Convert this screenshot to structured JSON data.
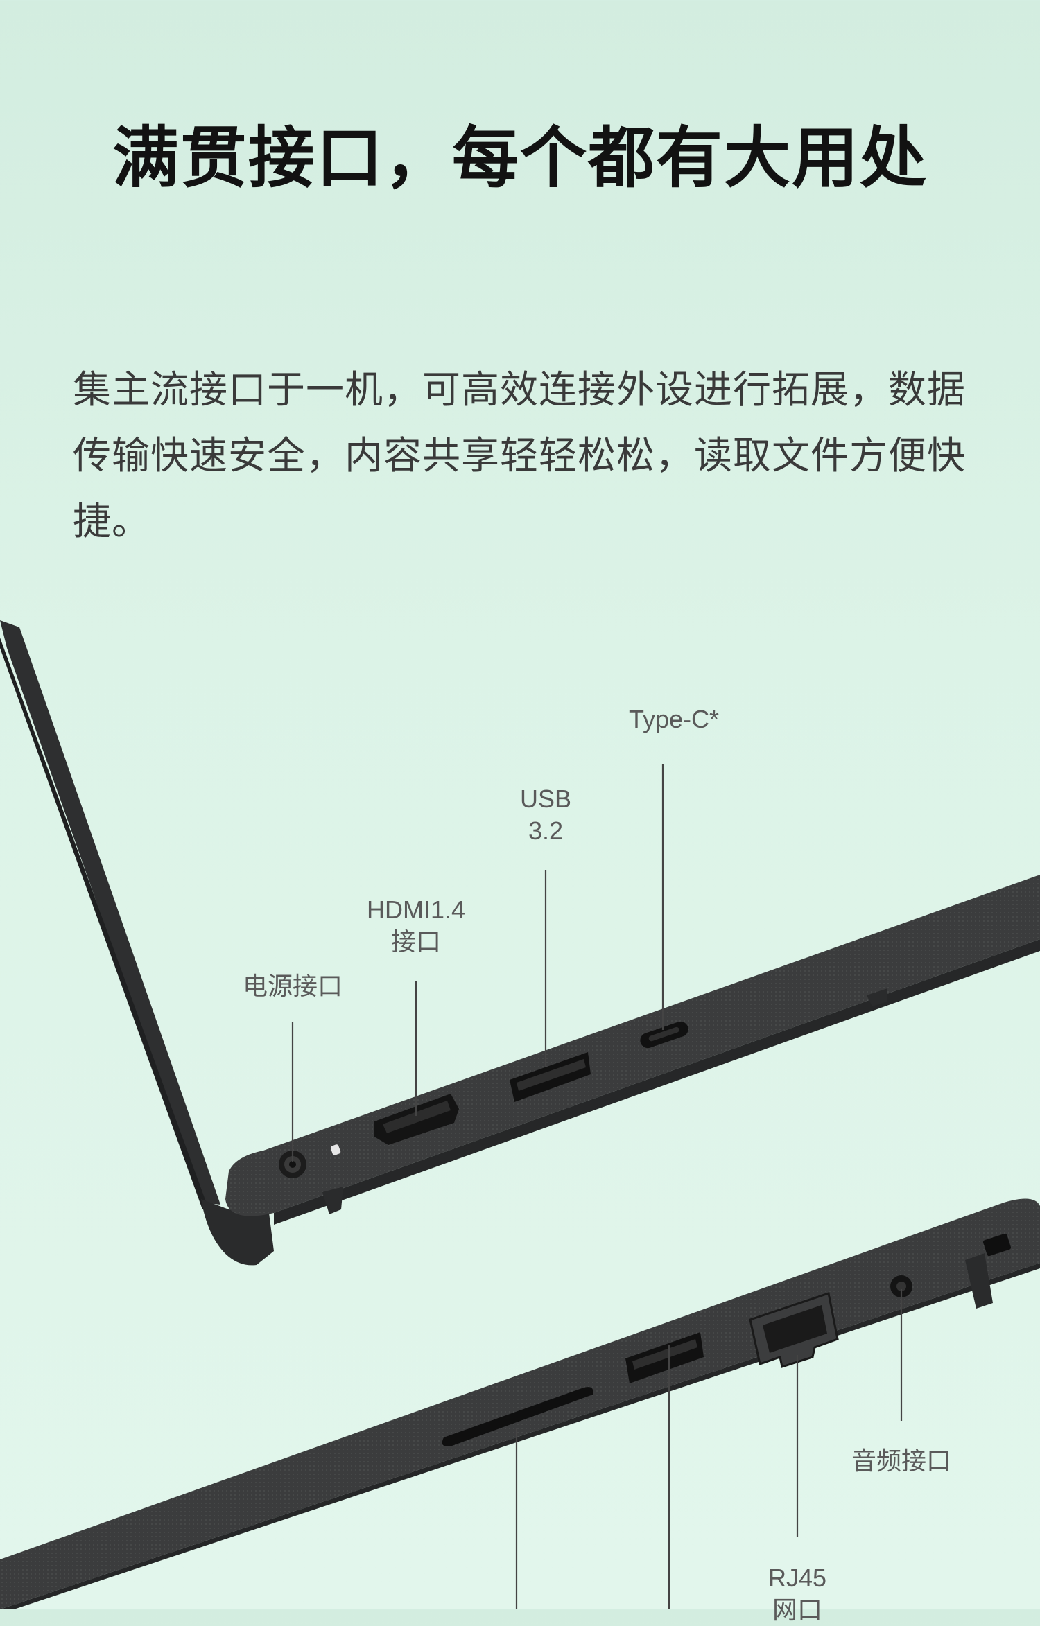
{
  "title": "满贯接口，每个都有大用处",
  "intro": "集主流接口于一机，可高效连接外设进行拓展，数据传输快速安全，内容共享轻轻松松，读取文件方便快捷。",
  "ports": {
    "power": "电源接口",
    "hdmi": "HDMI1.4\n接口",
    "usb32": "USB\n3.2",
    "typec": "Type-C*",
    "audio": "音频接口",
    "rj45": "RJ45\n网口"
  }
}
